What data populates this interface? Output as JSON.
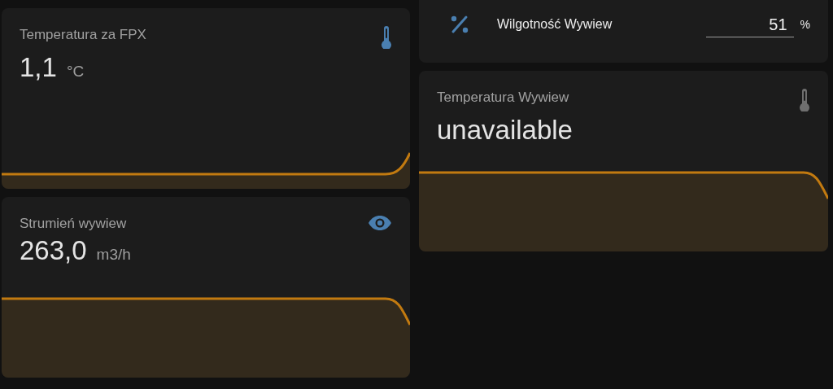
{
  "columns": [
    {
      "cards": [
        {
          "kind": "sensor",
          "name": "Temperatura za FPX",
          "value": "1,1",
          "unit": "°C",
          "available": true
        },
        {
          "kind": "sensor",
          "name": "Strumień wywiew",
          "value": "263,0",
          "unit": "m3/h",
          "available": true
        }
      ]
    },
    {
      "cards": [
        {
          "kind": "number",
          "name": "Wilgotność Wywiew",
          "value": "51",
          "unit": "%"
        },
        {
          "kind": "sensor",
          "name": "Temperatura Wywiew",
          "value": "unavailable",
          "available": false
        }
      ]
    }
  ]
}
